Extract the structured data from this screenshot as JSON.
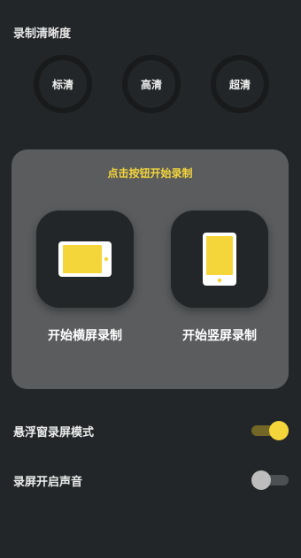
{
  "quality": {
    "title": "录制清晰度",
    "options": [
      {
        "label": "标清"
      },
      {
        "label": "高清"
      },
      {
        "label": "超清"
      }
    ]
  },
  "record": {
    "hint": "点击按钮开始录制",
    "landscape_label": "开始横屏录制",
    "portrait_label": "开始竖屏录制",
    "landscape_icon": "tablet-landscape-icon",
    "portrait_icon": "phone-portrait-icon"
  },
  "settings": {
    "floating_window": {
      "label": "悬浮窗录屏模式",
      "enabled": true
    },
    "record_audio": {
      "label": "录屏开启声音",
      "enabled": false
    }
  },
  "colors": {
    "background": "#232628",
    "card": "#5a5c5e",
    "accent": "#f4d53a"
  }
}
